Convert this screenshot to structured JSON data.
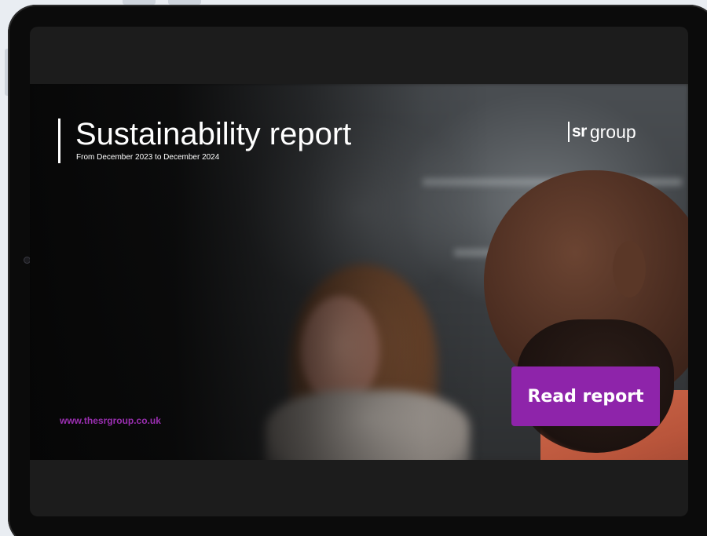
{
  "banner": {
    "title": "Sustainability report",
    "subtitle": "From December 2023 to December 2024",
    "url": "www.thesrgroup.co.uk",
    "cta_label": "Read report",
    "accent_color": "#8e24aa",
    "url_color": "#9b2fb2"
  },
  "logo": {
    "sr": "sr",
    "group": "group"
  }
}
